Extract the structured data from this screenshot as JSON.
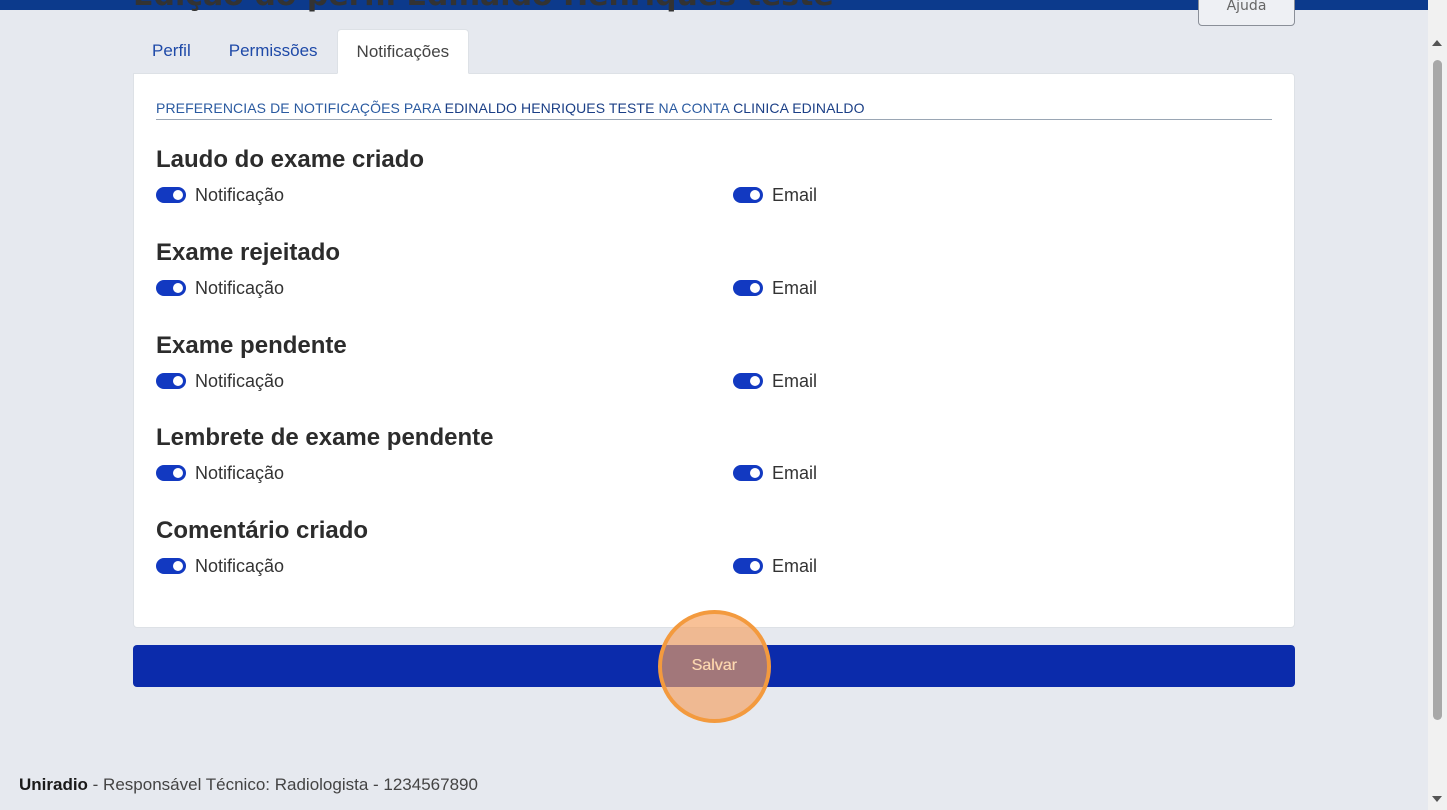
{
  "page": {
    "title": "Edição do perfil Edinaldo Henriques teste",
    "help_label": "Ajuda"
  },
  "tabs": [
    {
      "label": "Perfil",
      "active": false
    },
    {
      "label": "Permissões",
      "active": false
    },
    {
      "label": "Notificações",
      "active": true
    }
  ],
  "preferences_header": {
    "prefix": "PREFERENCIAS DE NOTIFICAÇÕES PARA",
    "user": "EDINALDO HENRIQUES TESTE",
    "middle": "NA CONTA",
    "account": "CLINICA EDINALDO"
  },
  "sections": [
    {
      "title": "Laudo do exame criado",
      "notification_label": "Notificação",
      "notification_on": true,
      "email_label": "Email",
      "email_on": true
    },
    {
      "title": "Exame rejeitado",
      "notification_label": "Notificação",
      "notification_on": true,
      "email_label": "Email",
      "email_on": true
    },
    {
      "title": "Exame pendente",
      "notification_label": "Notificação",
      "notification_on": true,
      "email_label": "Email",
      "email_on": true
    },
    {
      "title": "Lembrete de exame pendente",
      "notification_label": "Notificação",
      "notification_on": true,
      "email_label": "Email",
      "email_on": true
    },
    {
      "title": "Comentário criado",
      "notification_label": "Notificação",
      "notification_on": true,
      "email_label": "Email",
      "email_on": true
    }
  ],
  "save_label": "Salvar",
  "footer": {
    "brand": "Uniradio",
    "text": " - Responsável Técnico: Radiologista - 1234567890"
  },
  "colors": {
    "primary": "#0b2bab",
    "toggle_on": "#1239c1",
    "click_highlight": "#f39a3e"
  }
}
